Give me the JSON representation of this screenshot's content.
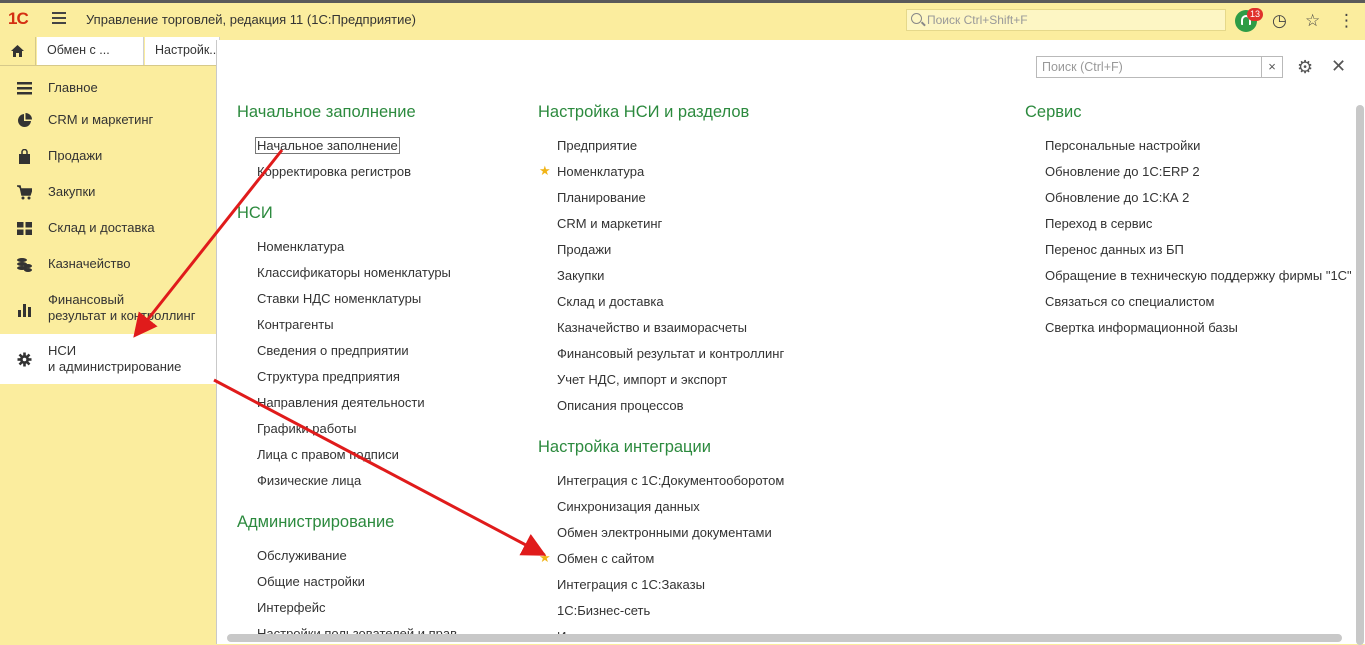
{
  "titlebar": {
    "logo": "1С",
    "title": "Управление торговлей, редакция 11  (1С:Предприятие)",
    "search_placeholder": "Поиск Ctrl+Shift+F",
    "notifications_count": "13"
  },
  "tabs": [
    {
      "label": "Обмен с ..."
    },
    {
      "label": "Настройк..."
    }
  ],
  "sidebar": {
    "items": [
      {
        "label": "Главное",
        "icon": "menu-icon"
      },
      {
        "label": "CRM и маркетинг",
        "icon": "pie-chart-icon"
      },
      {
        "label": "Продажи",
        "icon": "shopping-bag-icon"
      },
      {
        "label": "Закупки",
        "icon": "cart-icon"
      },
      {
        "label": "Склад и доставка",
        "icon": "warehouse-icon"
      },
      {
        "label": "Казначейство",
        "icon": "coins-icon"
      },
      {
        "label": "Финансовый",
        "label2": "результат и контроллинг",
        "icon": "bar-chart-icon"
      },
      {
        "label": "НСИ",
        "label2": "и администрирование",
        "icon": "gear-icon",
        "active": true
      }
    ]
  },
  "panel": {
    "search_placeholder": "Поиск (Ctrl+F)",
    "clear_label": "×",
    "col1": {
      "sections": [
        {
          "title": "Начальное заполнение",
          "items": [
            "Начальное заполнение",
            "Корректировка регистров"
          ]
        },
        {
          "title": "НСИ",
          "items": [
            "Номенклатура",
            "Классификаторы номенклатуры",
            "Ставки НДС номенклатуры",
            "Контрагенты",
            "Сведения о предприятии",
            "Структура предприятия",
            "Направления деятельности",
            "Графики работы",
            "Лица с правом подписи",
            "Физические лица"
          ]
        },
        {
          "title": "Администрирование",
          "items": [
            "Обслуживание",
            "Общие настройки",
            "Интерфейс",
            "Настройки пользователей и прав"
          ]
        }
      ]
    },
    "col2": {
      "sections": [
        {
          "title": "Настройка НСИ и разделов",
          "items": [
            "Предприятие",
            "Номенклатура",
            "Планирование",
            "CRM и маркетинг",
            "Продажи",
            "Закупки",
            "Склад и доставка",
            "Казначейство и взаиморасчеты",
            "Финансовый результат и контроллинг",
            "Учет НДС, импорт и экспорт",
            "Описания процессов"
          ]
        },
        {
          "title": "Настройка интеграции",
          "items": [
            "Интеграция с 1С:Документооборотом",
            "Синхронизация данных",
            "Обмен электронными документами",
            "Обмен с сайтом",
            "Интеграция с 1С:Заказы",
            "1С:Бизнес-сеть",
            "Интеграция с ..."
          ]
        }
      ]
    },
    "col3": {
      "sections": [
        {
          "title": "Сервис",
          "items": [
            "Персональные настройки",
            "Обновление до 1С:ERP 2",
            "Обновление до 1С:КА 2",
            "Переход в сервис",
            "Перенос данных из БП",
            "Обращение в техническую поддержку фирмы \"1С\"",
            "Связаться со специалистом",
            "Свертка информационной базы"
          ]
        }
      ]
    }
  },
  "colors": {
    "accent_bg": "#fbed9e",
    "section_title": "#2c8a3e",
    "favorite_star": "#f1b417",
    "annotation_arrow": "#e01b1b"
  }
}
